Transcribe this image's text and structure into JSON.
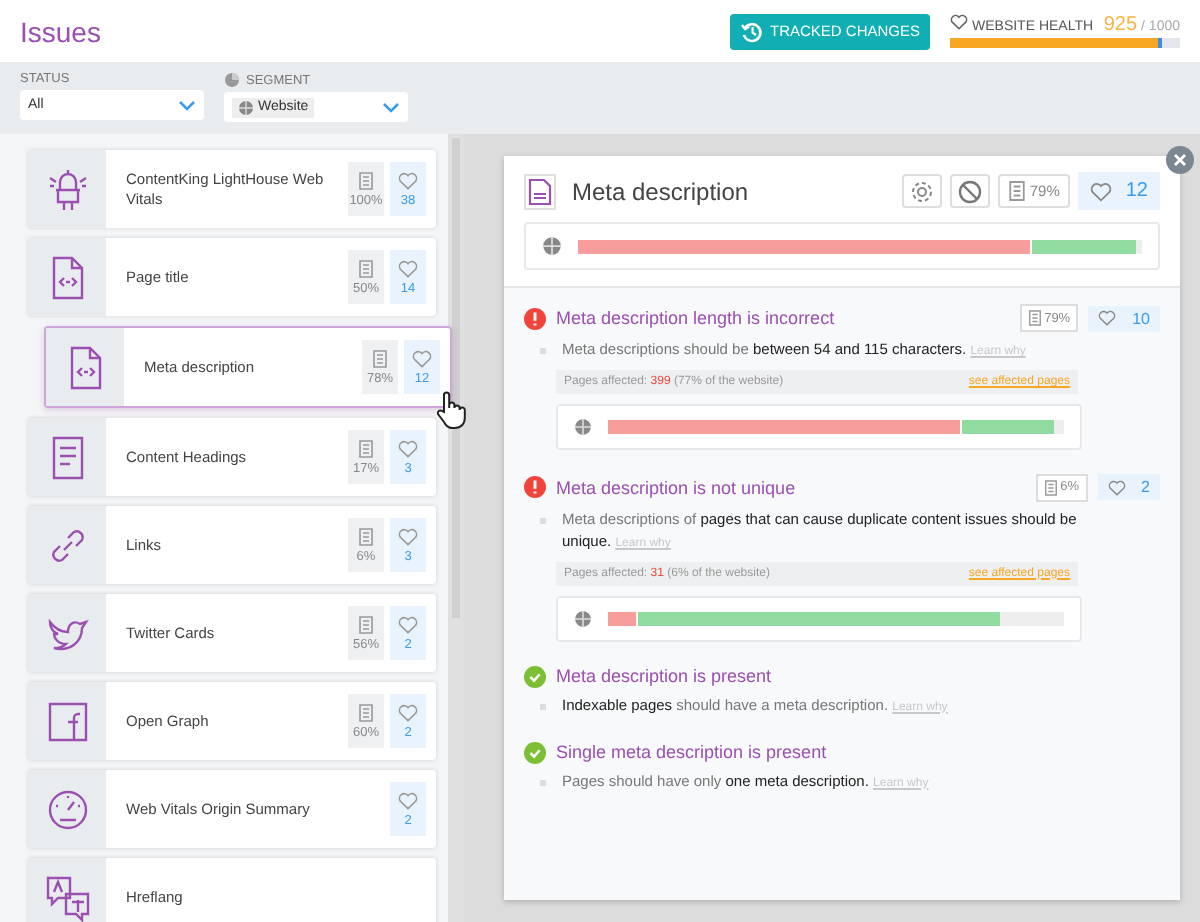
{
  "header": {
    "title": "Issues",
    "tracked_changes": "TRACKED CHANGES",
    "health": {
      "label": "WEBSITE HEALTH",
      "score": "925",
      "max": "/ 1000",
      "level": 0.925
    }
  },
  "filters": [
    {
      "kind": "status",
      "label": "STATUS",
      "value": "All"
    },
    {
      "kind": "segment",
      "label": "SEGMENT",
      "value": "Website"
    }
  ],
  "issues": [
    {
      "kind": "lighthouse",
      "title": "ContentKing LightHouse Web Vitals",
      "pages": "100%",
      "likes": "38",
      "selected": false
    },
    {
      "kind": "code-doc",
      "title": "Page title",
      "pages": "50%",
      "likes": "14",
      "selected": false
    },
    {
      "kind": "code-doc",
      "title": "Meta description",
      "pages": "78%",
      "likes": "12",
      "selected": true
    },
    {
      "kind": "lines-doc",
      "title": "Content Headings",
      "pages": "17%",
      "likes": "3",
      "selected": false
    },
    {
      "kind": "link",
      "title": "Links",
      "pages": "6%",
      "likes": "3",
      "selected": false
    },
    {
      "kind": "bird",
      "title": "Twitter Cards",
      "pages": "56%",
      "likes": "2",
      "selected": false
    },
    {
      "kind": "square",
      "title": "Open Graph",
      "pages": "60%",
      "likes": "2",
      "selected": false
    },
    {
      "kind": "gauge",
      "title": "Web Vitals Origin Summary",
      "likes": "2",
      "selected": false
    },
    {
      "kind": "translate",
      "title": "Hreflang",
      "selected": false
    }
  ],
  "detail": {
    "title": "Meta description",
    "pages": "79%",
    "likes": "12",
    "segments": [
      {
        "kind": "failed",
        "level": 0.8
      },
      {
        "kind": "passed",
        "level": 0.99
      }
    ],
    "checks": [
      {
        "kind": "failed",
        "title": "Meta description length is incorrect",
        "pages": "79%",
        "likes": "10",
        "description": "Meta descriptions should be **between 54 and 115 characters.**",
        "learn": "Learn why",
        "affected": {
          "label": "Pages affected:",
          "count": "399",
          "share": "(77% of the website)",
          "link": "see affected pages"
        },
        "segments": [
          {
            "kind": "failed",
            "level": 0.77
          },
          {
            "kind": "passed",
            "level": 0.98
          }
        ]
      },
      {
        "kind": "failed",
        "title": "Meta description is not unique",
        "pages": "6%",
        "likes": "2",
        "description": "Meta descriptions of **pages that can cause duplicate content issues should be unique.**",
        "learn": "Learn why",
        "affected": {
          "label": "Pages affected:",
          "count": "31",
          "share": "(6% of the website)",
          "link": "see affected pages"
        },
        "segments": [
          {
            "kind": "failed",
            "level": 0.06
          },
          {
            "kind": "passed",
            "level": 0.86
          }
        ]
      },
      {
        "kind": "passed",
        "title": "Meta description is present",
        "description": "**Indexable pages** should have a meta description.",
        "learn": "Learn why"
      },
      {
        "kind": "passed",
        "title": "Single meta description is present",
        "description": "Pages should have only **one meta description.**",
        "learn": "Learn why"
      }
    ]
  }
}
